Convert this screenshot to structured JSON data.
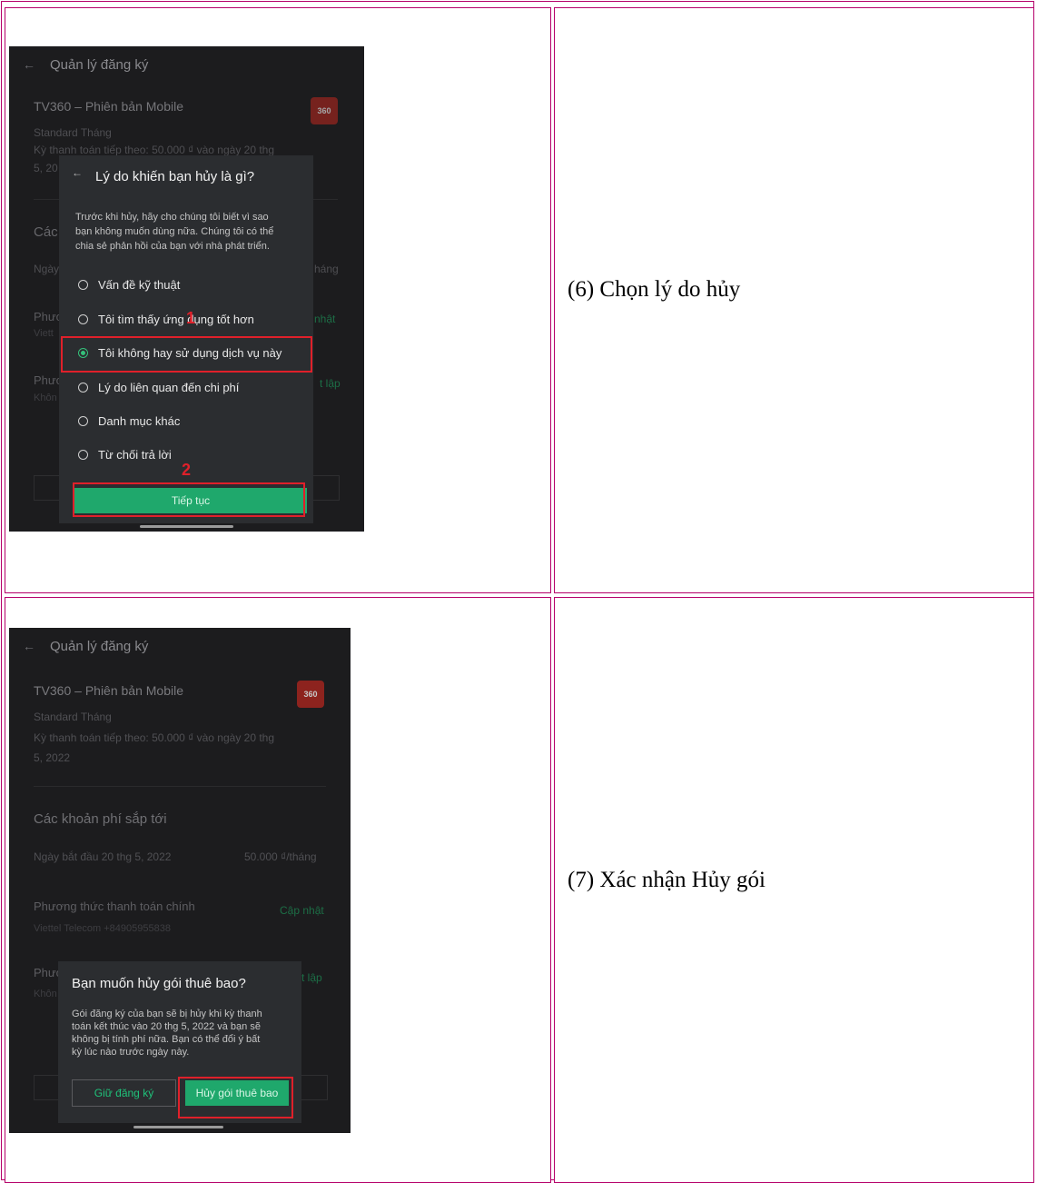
{
  "rows": [
    {
      "caption": "(6) Chọn lý do hủy",
      "screen": {
        "header_title": "Quản lý đăng ký",
        "app_name": "TV360 – Phiên bản Mobile",
        "app_icon_text": "360",
        "plan": "Standard Tháng",
        "next_payment_1": "Kỳ thanh toán tiếp theo: 50.000 ₫ vào ngày 20 thg",
        "next_payment_2": "5, 20",
        "bg_label_1": "Các",
        "bg_label_2": "Ngày",
        "bg_label_3": "Phươ",
        "bg_label_4": "Viett",
        "bg_label_5": "Phươ",
        "bg_label_6": "Khôn",
        "bg_right_1": "háng",
        "bg_right_2": "nhật",
        "bg_right_3": "t lập",
        "dialog": {
          "title": "Lý do khiến bạn hủy là gì?",
          "desc_1": "Trước khi hủy, hãy cho chúng tôi biết vì sao",
          "desc_2": "bạn không muốn dùng nữa. Chúng tôi có thể",
          "desc_3": "chia sẻ phản hồi của bạn với nhà phát triển.",
          "options": [
            "Vấn đề kỹ thuật",
            "Tôi tìm thấy ứng dụng tốt hơn",
            "Tôi không hay sử dụng dịch vụ này",
            "Lý do liên quan đến chi phí",
            "Danh mục khác",
            "Từ chối trả lời"
          ],
          "selected_index": 2,
          "continue_label": "Tiếp tục"
        },
        "marker_1": "1",
        "marker_2": "2"
      }
    },
    {
      "caption": "(7) Xác nhận Hủy gói",
      "screen": {
        "header_title": "Quản lý đăng ký",
        "app_name": "TV360 – Phiên bản Mobile",
        "app_icon_text": "360",
        "plan": "Standard Tháng",
        "next_payment_1": "Kỳ thanh toán tiếp theo: 50.000 ₫ vào ngày 20 thg",
        "next_payment_2": "5, 2022",
        "upcoming_title": "Các khoản phí sắp tới",
        "start_date": "Ngày bắt đầu 20 thg 5, 2022",
        "price": "50.000 ₫/tháng",
        "payment_method_title": "Phương thức thanh toán chính",
        "payment_method_value": "Viettel Telecom +84905955838",
        "update_label": "Cập nhật",
        "bg_label_1": "Phươ",
        "bg_label_2": "Khôn",
        "bg_right_1": "t lập",
        "dialog": {
          "title": "Bạn muốn hủy gói thuê bao?",
          "desc_1": "Gói đăng ký của bạn sẽ bị hủy khi kỳ thanh",
          "desc_2": "toán kết thúc vào 20 thg 5, 2022 và bạn sẽ",
          "desc_3": "không bị tính phí nữa. Bạn có thể đổi ý bất",
          "desc_4": "kỳ lúc nào trước ngày này.",
          "keep_label": "Giữ đăng ký",
          "cancel_label": "Hủy gói thuê bao"
        }
      }
    }
  ]
}
